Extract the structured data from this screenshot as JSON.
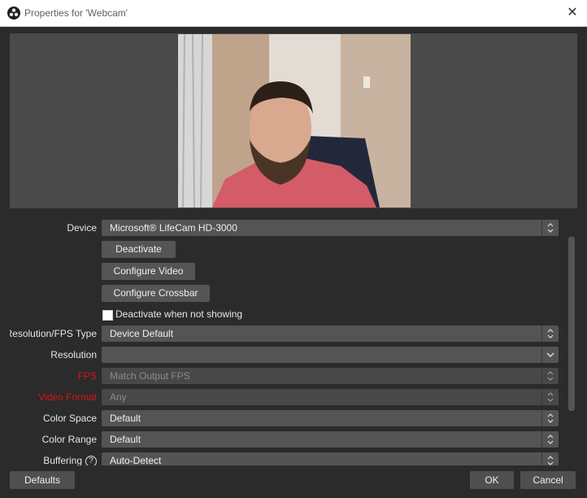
{
  "window": {
    "title": "Properties for 'Webcam'"
  },
  "preview": {
    "image": "webcam-person-image"
  },
  "device": {
    "label": "Device",
    "value": "Microsoft® LifeCam HD-3000",
    "deactivate_label": "Deactivate",
    "configure_video_label": "Configure Video",
    "configure_crossbar_label": "Configure Crossbar",
    "deactivate_when_not_showing_label": "Deactivate when not showing",
    "deactivate_when_not_showing_checked": false
  },
  "fields": {
    "resolution_fps_type": {
      "label": "Resolution/FPS Type",
      "value": "Device Default"
    },
    "resolution": {
      "label": "Resolution",
      "value": ""
    },
    "fps": {
      "label": "FPS",
      "value": "Match Output FPS"
    },
    "video_format": {
      "label": "Video Format",
      "value": "Any"
    },
    "color_space": {
      "label": "Color Space",
      "value": "Default"
    },
    "color_range": {
      "label": "Color Range",
      "value": "Default"
    },
    "buffering": {
      "label": "Buffering",
      "value": "Auto-Detect",
      "help_icon": "?"
    }
  },
  "footer": {
    "defaults_label": "Defaults",
    "ok_label": "OK",
    "cancel_label": "Cancel"
  },
  "colors": {
    "background": "#2b2b2b",
    "control": "#545454",
    "warning_label": "#d71414"
  }
}
